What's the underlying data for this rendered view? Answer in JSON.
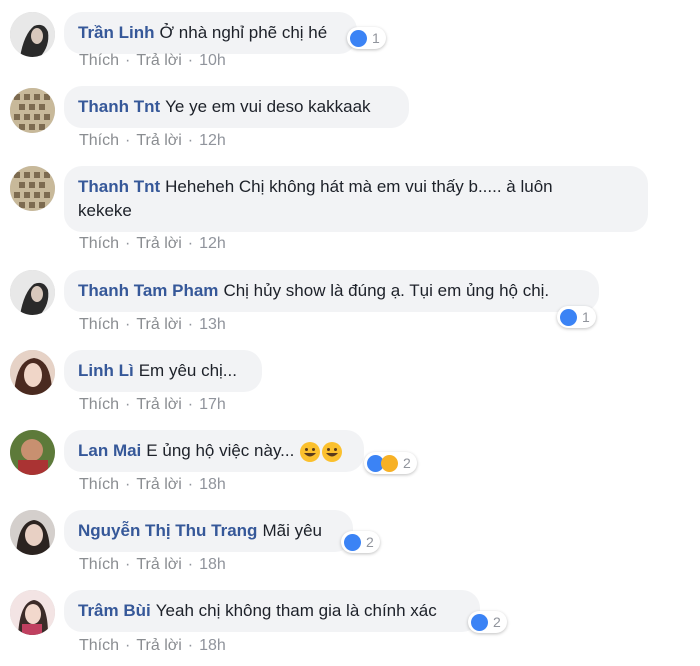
{
  "actions": {
    "like": "Thích",
    "reply": "Trả lời",
    "sep": "·"
  },
  "comments": [
    {
      "author": "Trần Linh",
      "text": "Ở nhà nghỉ phẽ chị hé",
      "time": "10h",
      "reactions": "1"
    },
    {
      "author": "Thanh Tnt",
      "text": "Ye ye em vui deso kakkaak",
      "time": "12h"
    },
    {
      "author": "Thanh Tnt",
      "text": "Heheheh Chị không hát mà em vui thấy b..... à luôn",
      "text2": "kekeke",
      "time": "12h"
    },
    {
      "author": "Thanh Tam Pham",
      "text": "Chị hủy show là đúng ạ. Tụi em ủng hộ chị.",
      "time": "13h",
      "reactions": "1"
    },
    {
      "author": "Linh Lì",
      "text": "Em yêu chị...",
      "time": "17h"
    },
    {
      "author": "Lan Mai",
      "text": "E ủng hộ việc này...",
      "time": "18h",
      "reactions": "2"
    },
    {
      "author": "Nguyễn Thị Thu Trang",
      "text": "Mãi yêu",
      "time": "18h",
      "reactions": "2"
    },
    {
      "author": "Trâm Bùi",
      "text": "Yeah chị không tham gia là chính xác",
      "time": "18h",
      "reactions": "2"
    }
  ],
  "colors": {
    "author": "#365899",
    "bubble": "#f2f3f5",
    "like": "#3b83f5",
    "haha": "#f7b125"
  }
}
